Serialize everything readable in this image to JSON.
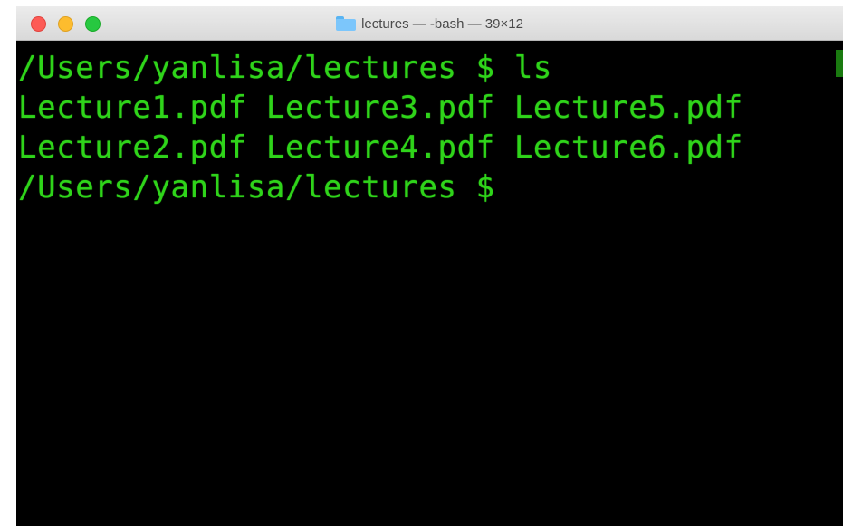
{
  "window": {
    "title": "lectures — -bash — 39×12",
    "folder_icon": "folder-icon"
  },
  "terminal": {
    "text_color": "#2fd41a",
    "background": "#000000",
    "lines": [
      "/Users/yanlisa/lectures $ ls",
      "Lecture1.pdf Lecture3.pdf Lecture5.pdf",
      "Lecture2.pdf Lecture4.pdf Lecture6.pdf",
      "/Users/yanlisa/lectures $"
    ]
  }
}
